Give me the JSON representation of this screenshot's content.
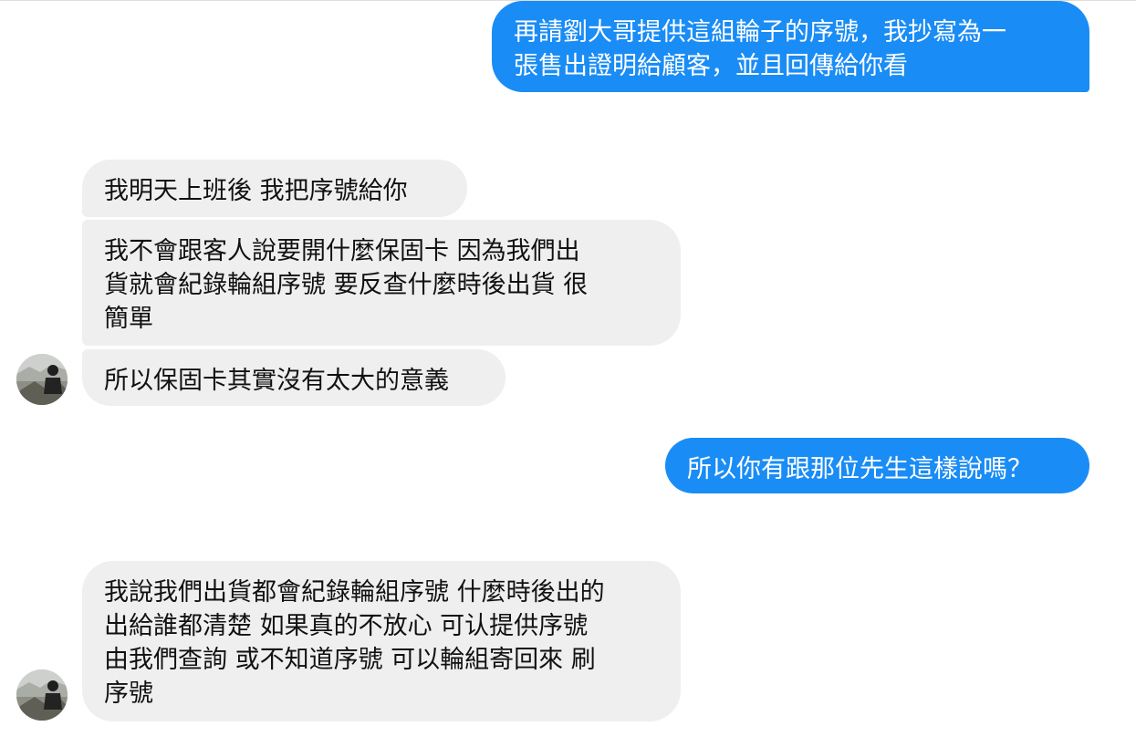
{
  "conversation": {
    "messages": [
      {
        "id": "m1",
        "direction": "outgoing",
        "text": "再請劉大哥提供這組輪子的序號，我抄寫為一\n張售出證明給顧客，並且回傳給你看"
      },
      {
        "id": "m2",
        "direction": "incoming",
        "text": "我明天上班後  我把序號給你"
      },
      {
        "id": "m3",
        "direction": "incoming",
        "text": "我不會跟客人說要開什麼保固卡  因為我們出\n貨就會紀錄輪組序號  要反查什麼時後出貨 很\n簡單"
      },
      {
        "id": "m4",
        "direction": "incoming",
        "text": "所以保固卡其實沒有太大的意義"
      },
      {
        "id": "m5",
        "direction": "outgoing",
        "text": "所以你有跟那位先生這樣說嗎？"
      },
      {
        "id": "m6",
        "direction": "incoming",
        "text": "我說我們出貨都會紀錄輪組序號 什麼時後出的\n出給誰都清楚  如果真的不放心 可认提供序號\n由我們查詢  或不知道序號 可以輪組寄回來 刷\n序號"
      }
    ],
    "avatar_icon": "user-avatar-photo-icon"
  },
  "colors": {
    "outgoing_bubble": "#1a8cf5",
    "incoming_bubble": "#efefef",
    "outgoing_text": "#ffffff",
    "incoming_text": "#111111"
  }
}
